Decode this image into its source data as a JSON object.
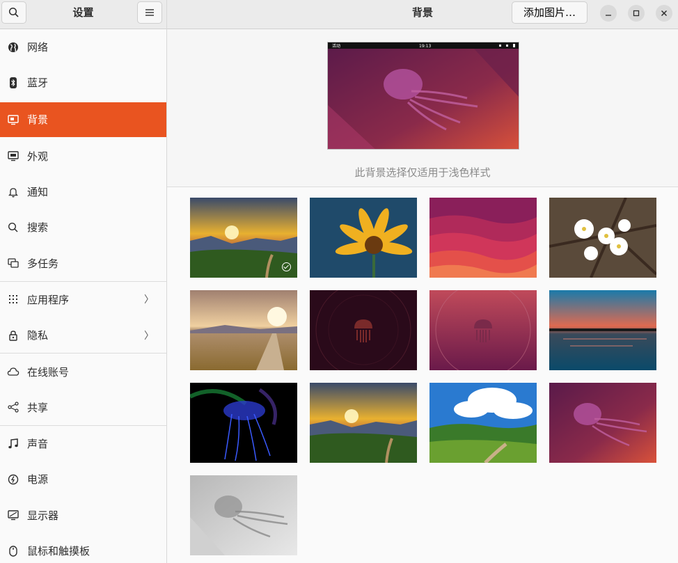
{
  "sidebar": {
    "title": "设置",
    "items": [
      {
        "label": "网络",
        "icon": "globe-icon"
      },
      {
        "label": "蓝牙",
        "icon": "bluetooth-icon"
      },
      {
        "label": "背景",
        "icon": "monitor-background-icon",
        "active": true
      },
      {
        "label": "外观",
        "icon": "appearance-icon"
      },
      {
        "label": "通知",
        "icon": "bell-icon"
      },
      {
        "label": "搜索",
        "icon": "search-icon"
      },
      {
        "label": "多任务",
        "icon": "multitasking-icon"
      },
      {
        "label": "应用程序",
        "icon": "apps-grid-icon",
        "has_arrow": true
      },
      {
        "label": "隐私",
        "icon": "lock-icon",
        "has_arrow": true
      },
      {
        "label": "在线账号",
        "icon": "cloud-icon"
      },
      {
        "label": "共享",
        "icon": "share-icon"
      },
      {
        "label": "声音",
        "icon": "music-note-icon"
      },
      {
        "label": "电源",
        "icon": "power-icon"
      },
      {
        "label": "显示器",
        "icon": "display-icon"
      },
      {
        "label": "鼠标和触摸板",
        "icon": "mouse-icon"
      }
    ],
    "arrow_glyph": "〉"
  },
  "header": {
    "title": "背景",
    "add_button": "添加图片…"
  },
  "preview": {
    "topbar_left": "活动",
    "topbar_time": "19:13",
    "caption": "此背景选择仅适用于浅色样式"
  },
  "colors": {
    "accent": "#e95420",
    "header_bg": "#ebebeb"
  },
  "wallpapers": [
    {
      "name": "sunset-valley",
      "selected": true
    },
    {
      "name": "yellow-daisy"
    },
    {
      "name": "magenta-waves"
    },
    {
      "name": "cherry-blossom"
    },
    {
      "name": "wheat-field-road"
    },
    {
      "name": "dark-jellyfish-logo"
    },
    {
      "name": "purple-jellyfish-logo"
    },
    {
      "name": "lake-sunset"
    },
    {
      "name": "glowing-blue-jellyfish"
    },
    {
      "name": "sunrise-valley"
    },
    {
      "name": "green-hills-clouds"
    },
    {
      "name": "jammy-jellyfish-purple"
    },
    {
      "name": "jammy-jellyfish-gray"
    }
  ]
}
